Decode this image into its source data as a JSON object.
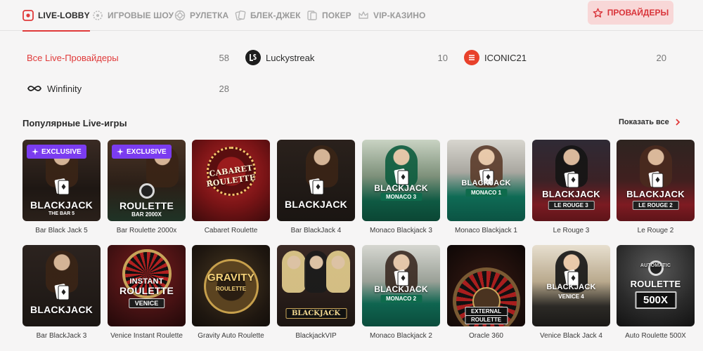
{
  "nav": {
    "tabs": [
      {
        "label": "LIVE-LOBBY",
        "icon": "live-lobby-icon",
        "active": true
      },
      {
        "label": "ИГРОВЫЕ ШОУ",
        "icon": "game-show-icon"
      },
      {
        "label": "РУЛЕТКА",
        "icon": "roulette-icon"
      },
      {
        "label": "БЛЕК-ДЖЕК",
        "icon": "cards-icon"
      },
      {
        "label": "ПОКЕР",
        "icon": "poker-icon"
      },
      {
        "label": "VIP-КАЗИНО",
        "icon": "crown-icon"
      }
    ],
    "providers_button": "ПРОВАЙДЕРЫ"
  },
  "providers": [
    {
      "name": "Все Live-Провайдеры",
      "count": "58"
    },
    {
      "name": "Luckystreak",
      "count": "10"
    },
    {
      "name": "ICONIC21",
      "count": "20"
    },
    {
      "name": "Winfinity",
      "count": "28"
    }
  ],
  "section": {
    "title": "Популярные Live-игры",
    "show_all": "Показать все"
  },
  "badge_label": "EXCLUSIVE",
  "games": [
    {
      "caption": "Bar Black Jack 5",
      "line1": "BLACKJACK",
      "line2": "THE BAR 5"
    },
    {
      "caption": "Bar Roulette 2000x",
      "line1": "ROULETTE",
      "line2": "BAR 2000X"
    },
    {
      "caption": "Cabaret Roulette",
      "line1": "CABARET",
      "line2": "ROULETTE"
    },
    {
      "caption": "Bar BlackJack 4",
      "line1": "BLACKJACK",
      "line2": ""
    },
    {
      "caption": "Monaco Blackjack 3",
      "line1": "BLACKJACK",
      "line2": "MONACO 3"
    },
    {
      "caption": "Monaco Blackjack 1",
      "line1": "BLACKJACK",
      "line2": "MONACO 1"
    },
    {
      "caption": "Le Rouge 3",
      "line1": "BLACKJACK",
      "line2": "LE ROUGE 3"
    },
    {
      "caption": "Le Rouge 2",
      "line1": "BLACKJACK",
      "line2": "LE ROUGE 2"
    },
    {
      "caption": "Bar BlackJack 3",
      "line1": "BLACKJACK",
      "line2": ""
    },
    {
      "caption": "Venice Instant Roulette",
      "line1": "INSTANT",
      "line1b": "ROULETTE",
      "line2": "VENICE"
    },
    {
      "caption": "Gravity Auto Roulette",
      "line1": "GRAVITY",
      "line2": "ROULETTE"
    },
    {
      "caption": "BlackjackVIP",
      "line1": "BLACKJACK",
      "line2": ""
    },
    {
      "caption": "Monaco Blackjack 2",
      "line1": "BLACKJACK",
      "line2": "MONACO 2"
    },
    {
      "caption": "Oracle 360",
      "line1": "EXTERNAL",
      "line2": "ROULETTE"
    },
    {
      "caption": "Venice Black Jack 4",
      "line1": "BLACKJACK",
      "line2": "VENICE 4"
    },
    {
      "caption": "Auto Roulette 500X",
      "line1": "AUTOMATIC",
      "line1b": "ROULETTE",
      "line2": "500X"
    }
  ],
  "colors": {
    "accent": "#e03a3a",
    "badge": "#7b3cf0"
  }
}
